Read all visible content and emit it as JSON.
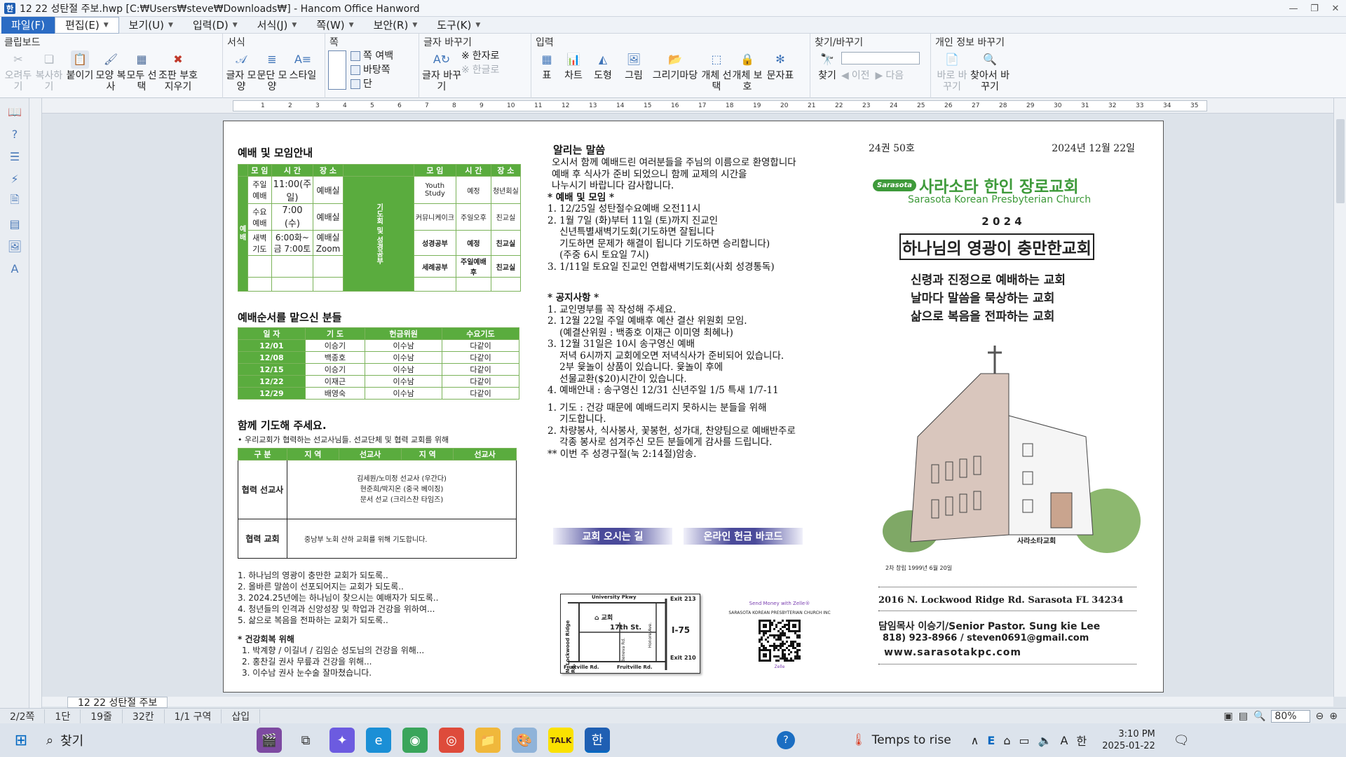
{
  "window": {
    "title": "12    22   성탄절 주보.hwp [C:₩Users₩steve₩Downloads₩] - Hancom Office Hanword",
    "app_icon_label": "한"
  },
  "menu": {
    "items": [
      "파일(F)",
      "편집(E)",
      "보기(U)",
      "입력(D)",
      "서식(J)",
      "쪽(W)",
      "보안(R)",
      "도구(K)"
    ]
  },
  "ribbon": {
    "groups": [
      {
        "title": "클립보드",
        "buttons": [
          {
            "label": "오려두기",
            "disabled": true
          },
          {
            "label": "복사하기",
            "disabled": true
          },
          {
            "label": "붙이기",
            "disabled": false
          },
          {
            "label": "모양 복사",
            "disabled": false
          },
          {
            "label": "모두 선택",
            "disabled": false
          },
          {
            "label": "조판 부호 지우기",
            "disabled": false
          }
        ]
      },
      {
        "title": "서식",
        "buttons": [
          {
            "label": "글자 모양"
          },
          {
            "label": "문단 모양"
          },
          {
            "label": "스타일"
          }
        ]
      },
      {
        "title": "쪽",
        "small": [
          "쪽 여백",
          "바탕쪽",
          "단"
        ]
      },
      {
        "title": "글자 바꾸기",
        "buttons": [
          {
            "label": "글자 바꾸기"
          }
        ],
        "small": [
          "한자로",
          "한글로"
        ]
      },
      {
        "title": "입력",
        "buttons": [
          {
            "label": "표"
          },
          {
            "label": "차트"
          },
          {
            "label": "도형"
          },
          {
            "label": "그림"
          },
          {
            "label": "그리기마당"
          },
          {
            "label": "개체 선택"
          },
          {
            "label": "개체 보호"
          },
          {
            "label": "문자표"
          }
        ]
      },
      {
        "title": "찾기/바꾸기",
        "buttons": [
          {
            "label": "찾기"
          }
        ],
        "small": [
          "이전",
          "다음"
        ]
      },
      {
        "title": "개인 정보 바꾸기",
        "buttons": [
          {
            "label": "바로 바꾸기",
            "disabled": true
          },
          {
            "label": "찾아서 바꾸기"
          }
        ]
      }
    ]
  },
  "doc": {
    "left": {
      "worship_title": "예배 및 모임안내",
      "worship_headers": [
        "모 임",
        "시 간",
        "장 소",
        "모 임",
        "시 간",
        "장 소"
      ],
      "worship_side_left": "예 배",
      "worship_side_right": "기도회 및 성경공부",
      "worship_rows": [
        [
          "주일예배",
          "11:00(주일)",
          "예배실",
          "Youth Study",
          "예정",
          "청년회실"
        ],
        [
          "수요예배",
          "7:00 (수)",
          "예배실",
          "커뮤니케이크",
          "주일오후",
          "친교실"
        ],
        [
          "새벽기도",
          "6:00화~금 7:00토",
          "예배실 Zoom",
          "성경공부",
          "예정",
          "친교실"
        ],
        [
          "",
          "",
          "",
          "세례공부",
          "주일예배 후",
          "친교실"
        ]
      ],
      "order_title": "예배순서를 맡으신 분들",
      "order_headers": [
        "일 자",
        "기 도",
        "헌금위원",
        "수요기도"
      ],
      "order_rows": [
        [
          "12/01",
          "이승기",
          "이수남",
          "다같이"
        ],
        [
          "12/08",
          "백종호",
          "이수남",
          "다같이"
        ],
        [
          "12/15",
          "이승기",
          "이수남",
          "다같이"
        ],
        [
          "12/22",
          "이재근",
          "이수남",
          "다같이"
        ],
        [
          "12/29",
          "배영숙",
          "이수남",
          "다같이"
        ]
      ],
      "prayer_title": "함께 기도해 주세요.",
      "prayer_sub": "• 우리교회가 협력하는 선교사님들. 선교단체 및 협력 교회를 위해",
      "mission_headers": [
        "구 분",
        "지 역",
        "선교사",
        "지 역",
        "선교사"
      ],
      "mission_r1_label": "협력 선교사",
      "mission_r1_lines": [
        "김세원/노미정 선교사 (우간다)",
        "현준희/박지온 (중국 베이징)",
        "문서 선교 (크리스찬 타임즈)"
      ],
      "mission_r2_label": "협력 교회",
      "mission_r2_text": "중남부 노회 산하 교회를 위해 기도합니다.",
      "prayers": [
        "1. 하나님의 영광이 충만한 교회가 되도록..",
        "2. 올바른 말씀이 선포되어지는 교회가 되도록..",
        "3. 2024.25년에는 하나님이 찾으시는 예배자가 되도록..",
        "4. 청년들의 인격과 신앙성장 및 학업과 건강을 위하여...",
        "5. 삶으로 복음을 전파하는 교회가 되도록.."
      ],
      "health_title": "* 건강회복 위해",
      "health": [
        "1. 박계향 / 이길녀 / 김임순 성도님의 건강을 위해...",
        "2. 홍찬길 권사 무릎과 건강을 위해...",
        "3. 이수남 권사 눈수술 잘마쳤습니다."
      ]
    },
    "middle": {
      "title": "알리는 말씀",
      "intro": [
        "오시서 함께 예배드린 여러분들을 주님의 이름으로 환영합니다",
        "예배 후 식사가 준비 되었으니 함께 교제의 시간을",
        "나누시기 바랍니다 감사합니다."
      ],
      "worship_head": "* 예배 및 모임 *",
      "worship_items": [
        "1. 12/25일 성탄절수요예배 오전11시",
        "2. 1월 7일 (화)부터 11일 (토)까지 진교인",
        "    신년특별새벽기도회(기도하면 잘됩니다",
        "    기도하면 문제가 해결이 됩니다 기도하면 승리합니다)",
        "    (주중 6시 토요일 7시)",
        "3. 1/11일 토요일 진교인 연합새벽기도회(사회 성경통독)"
      ],
      "notice_head": "* 공지사항 *",
      "notice_items": [
        "1. 교인명부를 꼭 작성해 주세요.",
        "2. 12월 22일 주일 예배후 예산 결산 위원회 모임.",
        "    (예결산위원 : 백종호 이재근 이미영 최혜나)",
        "3. 12월 31일은 10시 송구영신 예배",
        "    저녁 6시까지 교회에오면 저녁식사가 준비되어 있습니다.",
        "    2부 윷놀이 상품이 있습니다. 윷놀이 후에",
        "    선물교환($20)시간이 있습니다.",
        "4. 예배안내 : 송구영신 12/31 신년주일 1/5 특새 1/7-11"
      ],
      "extra_items": [
        "1. 기도 : 건강 때문에 예배드리지 못하시는 분들을 위해",
        "    기도합니다.",
        "2. 차량봉사, 식사봉사, 꽃봉헌, 성가대, 찬양팀으로 예배반주로",
        "    각종 봉사로 섬겨주신 모든 분들에게 감사를 드립니다.",
        "** 이번 주 성경구절(눅 2:14절)암송."
      ],
      "bar_left": "교회 오시는 길",
      "bar_right": "온라인 헌금 바코드",
      "map_labels": {
        "top": "University Pkwy",
        "exit1": "Exit 213",
        "church": "교회",
        "street": "17th St.",
        "road_left": "N. Lockwood Ridge Rd.",
        "road_mid": "Beneva Rd.",
        "road_right": "Honore Ave.",
        "hwy": "I-75",
        "exit2": "Exit 210",
        "bottom_left": "Fruitville Rd.",
        "bottom_mid": "Fruitville Rd."
      },
      "zelle_top": "Send Money with Zelle®",
      "zelle_name": "SARASOTA KOREAN PRESBYTERIAN CHURCH INC",
      "zelle_bottom": "Zelle"
    },
    "right": {
      "volume": "24권 50호",
      "date": "2024년 12월 22일",
      "logo_badge": "Sarasota",
      "church_kr": "사라소타 한인 장로교회",
      "church_en": "Sarasota Korean Presbyterian Church",
      "year": "2 0 2 4",
      "motto_box": "하나님의 영광이 충만한교회",
      "mottos": [
        "신령과 진정으로 예배하는 교회",
        "날마다 말씀을 묵상하는 교회",
        "삶으로 복음을 전파하는 교회"
      ],
      "sign": "사라소타교회",
      "founded": "2차 창립 1999년 6월 20일",
      "address": "2016 N. Lockwood Ridge Rd. Sarasota FL 34234",
      "pastor": "담임목사 이승기/Senior Pastor. Sung kie Lee",
      "contact": "818) 923-8966 / steven0691@gmail.com",
      "web": "www.sarasotakpc.com"
    }
  },
  "doctab": "12    22   성탄절 주보",
  "status": {
    "page": "2/2쪽",
    "col": "1단",
    "line": "19줄",
    "char": "32칸",
    "section": "1/1 구역",
    "mode": "삽입",
    "zoom": "80%"
  },
  "taskbar": {
    "search": "찾기",
    "weather": "Temps to rise",
    "time": "3:10 PM",
    "date": "2025-01-22",
    "ime": "한",
    "lang": "A"
  },
  "colors": {
    "table_green": "#5aac3e",
    "accent_blue": "#2b6cc4",
    "bar_purple": "#4a4a9a"
  }
}
